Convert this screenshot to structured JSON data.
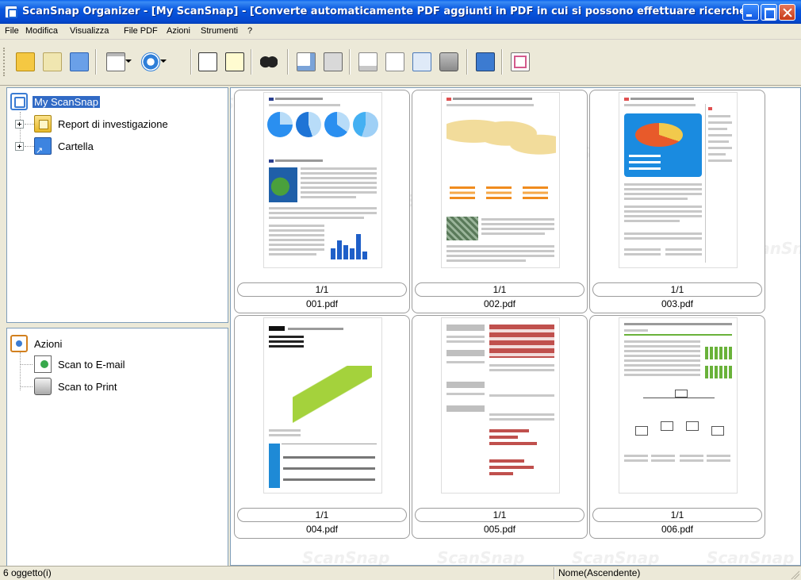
{
  "window": {
    "title": "ScanSnap Organizer - [My ScanSnap] - [Converte automaticamente PDF aggiunti in PDF in cui si possono effettuare ricerche]"
  },
  "menu": [
    "File",
    "Modifica",
    "Visualizza",
    "File PDF",
    "Azioni",
    "Strumenti",
    "?"
  ],
  "toolbar": {
    "icons": [
      "new-cabinet-icon",
      "new-folder-icon",
      "shortcut-folder-icon",
      "layout-icon",
      "rotate-icon",
      "ocr-icon",
      "ocr-marker-icon",
      "search-icon",
      "send-icon",
      "print-icon",
      "merge-pdf-icon",
      "edit-pdf-icon",
      "text-recognition-icon",
      "trash-icon",
      "tools-icon",
      "zoom-icon"
    ]
  },
  "tree": {
    "root": "My ScanSnap",
    "children": [
      {
        "label": "Report di investigazione",
        "icon": "cabinet-folder-icon"
      },
      {
        "label": "Cartella",
        "icon": "shortcut-folder-icon"
      }
    ]
  },
  "actions": {
    "title": "Azioni",
    "items": [
      {
        "label": "Scan to E-mail",
        "icon": "email-scanner-icon"
      },
      {
        "label": "Scan to Print",
        "icon": "printer-icon"
      }
    ]
  },
  "documents": [
    {
      "page": "1/1",
      "name": "001.pdf"
    },
    {
      "page": "1/1",
      "name": "002.pdf"
    },
    {
      "page": "1/1",
      "name": "003.pdf"
    },
    {
      "page": "1/1",
      "name": "004.pdf"
    },
    {
      "page": "1/1",
      "name": "005.pdf"
    },
    {
      "page": "1/1",
      "name": "006.pdf"
    }
  ],
  "watermark": "ScanSnap",
  "status": {
    "count": "6 oggetto(i)",
    "sort": "Nome(Ascendente)"
  },
  "colors": {
    "titlebar": "#0a58df",
    "selection": "#316ac5",
    "pie_blue": "#2a8ff0",
    "map_yellow": "#f2dc9b",
    "japan_green": "#a4d23c",
    "chart_green": "#6ab23a",
    "table_red": "#c0504d"
  }
}
